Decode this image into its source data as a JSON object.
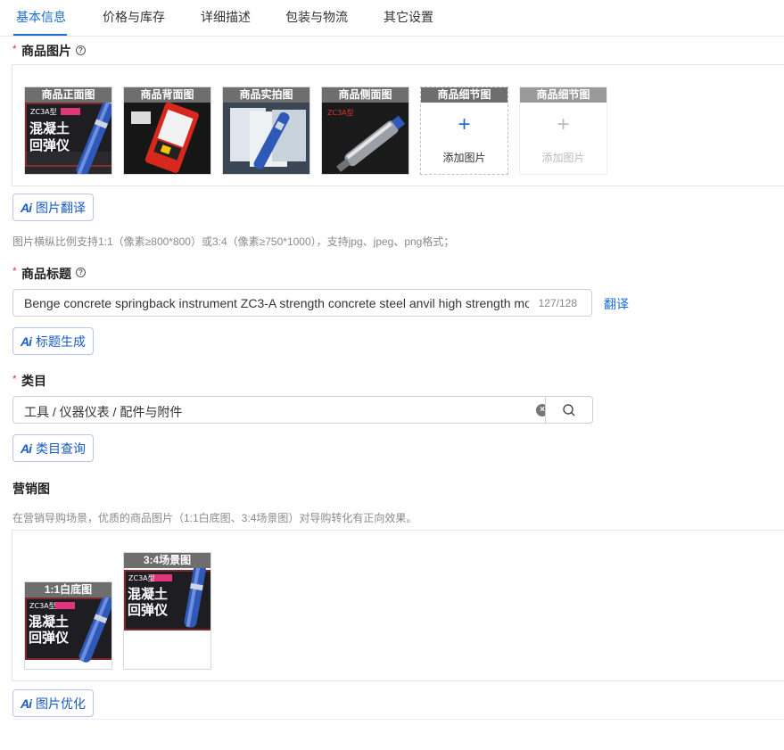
{
  "tabs": [
    {
      "label": "基本信息"
    },
    {
      "label": "价格与库存"
    },
    {
      "label": "详细描述"
    },
    {
      "label": "包装与物流"
    },
    {
      "label": "其它设置"
    }
  ],
  "product_images": {
    "label": "商品图片",
    "required_mark": "*",
    "help": "?",
    "slots": [
      {
        "caption": "商品正面图",
        "badge": "ZC3A型",
        "line1": "混凝土",
        "line2": "回弹仪"
      },
      {
        "caption": "商品背面图"
      },
      {
        "caption": "商品实拍图"
      },
      {
        "caption": "商品侧面图",
        "line1": "ZC3A型"
      },
      {
        "caption": "商品细节图",
        "add_label": "添加图片"
      },
      {
        "caption": "商品细节图",
        "add_label": "添加图片"
      }
    ],
    "plus_glyph": "+",
    "ai_button": {
      "ai": "Ai",
      "label": "图片翻译"
    },
    "hint": "图片横纵比例支持1:1（像素≥800*800）或3:4（像素≥750*1000），支持jpg、jpeg、png格式；"
  },
  "product_title": {
    "label": "商品标题",
    "required_mark": "*",
    "help": "?",
    "value": "Benge concrete springback instrument ZC3-A strength concrete steel anvil high strength mo",
    "counter": "127/128",
    "translate_link": "翻译",
    "ai_button": {
      "ai": "Ai",
      "label": "标题生成"
    }
  },
  "category": {
    "label": "类目",
    "required_mark": "*",
    "value": "工具 / 仪器仪表 / 配件与附件",
    "clear": "×",
    "ai_button": {
      "ai": "Ai",
      "label": "类目查询"
    }
  },
  "marketing": {
    "label": "营销图",
    "hint": "在营销导购场景，优质的商品图片（1:1白底图、3:4场景图）对导购转化有正向效果。",
    "slots": [
      {
        "caption": "1:1白底图",
        "badge": "ZC3A型",
        "line1": "混凝土",
        "line2": "回弹仪"
      },
      {
        "caption": "3:4场景图",
        "badge": "ZC3A型",
        "line1": "混凝土",
        "line2": "回弹仪"
      }
    ],
    "ai_button": {
      "ai": "Ai",
      "label": "图片优化"
    }
  },
  "colors": {
    "accent": "#1a6cd6",
    "required": "#e53935",
    "caption_bg": "#6e6e6e"
  }
}
